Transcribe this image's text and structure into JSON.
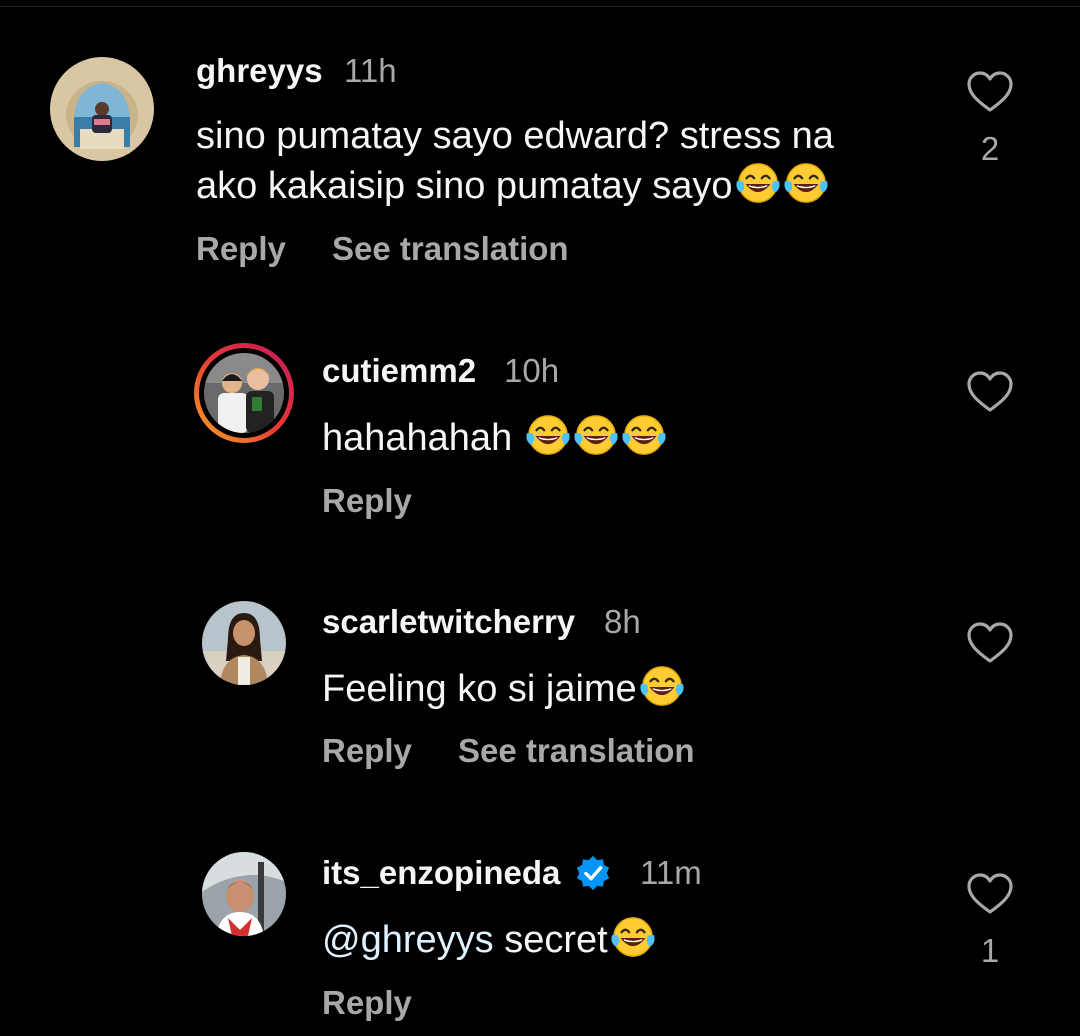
{
  "comments": [
    {
      "username": "ghreyys",
      "time": "11h",
      "text_line1": "sino pumatay sayo edward? stress na",
      "text_line2": "ako kakaisip sino pumatay sayo",
      "reply": "Reply",
      "translate": "See translation",
      "likes": "2",
      "verified": false
    },
    {
      "username": "cutiemm2",
      "time": "10h",
      "text": "hahahahah ",
      "reply": "Reply",
      "likes": "",
      "verified": false
    },
    {
      "username": "scarletwitcherry",
      "time": "8h",
      "text": "Feeling ko si jaime",
      "reply": "Reply",
      "translate": "See translation",
      "likes": "",
      "verified": false
    },
    {
      "username": "its_enzopineda",
      "time": "11m",
      "mention": "@ghreyys",
      "text": " secret",
      "reply": "Reply",
      "likes": "1",
      "verified": true
    }
  ],
  "icons": {
    "like": "heart-outline-icon",
    "emoji": "face-with-tears-of-joy-emoji",
    "verified": "verified-badge-icon"
  },
  "colors": {
    "background": "#000000",
    "primary_text": "#f5f5f5",
    "secondary_text": "#a8a8a8",
    "verified_blue": "#0095f6",
    "story_ring_start": "#f9a825",
    "story_ring_end": "#c2185b"
  }
}
